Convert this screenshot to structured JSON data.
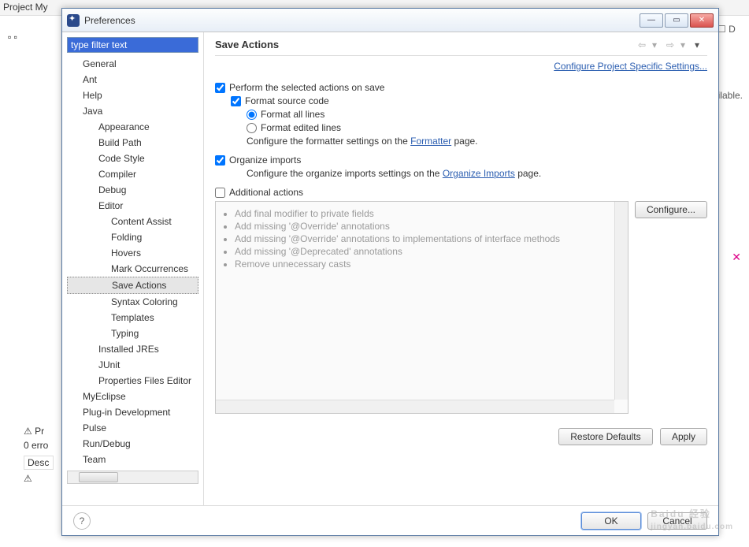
{
  "bg": {
    "menu": "Project   My",
    "ilable": "ilable.",
    "problems_tab": "Pr",
    "errors": "0 erro",
    "desc": "Desc",
    "d_label": "D"
  },
  "dialog": {
    "title": "Preferences",
    "filter": "type filter text",
    "tree": [
      {
        "label": "General",
        "lvl": 1
      },
      {
        "label": "Ant",
        "lvl": 1
      },
      {
        "label": "Help",
        "lvl": 1
      },
      {
        "label": "Java",
        "lvl": 1
      },
      {
        "label": "Appearance",
        "lvl": 2
      },
      {
        "label": "Build Path",
        "lvl": 2
      },
      {
        "label": "Code Style",
        "lvl": 2
      },
      {
        "label": "Compiler",
        "lvl": 2
      },
      {
        "label": "Debug",
        "lvl": 2
      },
      {
        "label": "Editor",
        "lvl": 2
      },
      {
        "label": "Content Assist",
        "lvl": 3
      },
      {
        "label": "Folding",
        "lvl": 3
      },
      {
        "label": "Hovers",
        "lvl": 3
      },
      {
        "label": "Mark Occurrences",
        "lvl": 3
      },
      {
        "label": "Save Actions",
        "lvl": 3,
        "sel": true
      },
      {
        "label": "Syntax Coloring",
        "lvl": 3
      },
      {
        "label": "Templates",
        "lvl": 3
      },
      {
        "label": "Typing",
        "lvl": 3
      },
      {
        "label": "Installed JREs",
        "lvl": 2
      },
      {
        "label": "JUnit",
        "lvl": 2
      },
      {
        "label": "Properties Files Editor",
        "lvl": 2
      },
      {
        "label": "MyEclipse",
        "lvl": 1
      },
      {
        "label": "Plug-in Development",
        "lvl": 1
      },
      {
        "label": "Pulse",
        "lvl": 1
      },
      {
        "label": "Run/Debug",
        "lvl": 1
      },
      {
        "label": "Team",
        "lvl": 1
      }
    ],
    "page_title": "Save Actions",
    "project_link": "Configure Project Specific Settings...",
    "opts": {
      "perform": "Perform the selected actions on save",
      "format": "Format source code",
      "format_all": "Format all lines",
      "format_edited": "Format edited lines",
      "formatter_note_a": "Configure the formatter settings on the ",
      "formatter_link": "Formatter",
      "formatter_note_b": " page.",
      "organize": "Organize imports",
      "organize_note_a": "Configure the organize imports settings on the ",
      "organize_link": "Organize Imports",
      "organize_note_b": " page.",
      "additional": "Additional actions"
    },
    "actions": [
      "Add final modifier to private fields",
      "Add missing '@Override' annotations",
      "Add missing '@Override' annotations to implementations of interface methods",
      "Add missing '@Deprecated' annotations",
      "Remove unnecessary casts"
    ],
    "buttons": {
      "configure": "Configure...",
      "restore": "Restore Defaults",
      "apply": "Apply",
      "ok": "OK",
      "cancel": "Cancel"
    }
  },
  "watermark": {
    "main": "Baidu 经验",
    "sub": "jingyan.baidu.com"
  }
}
